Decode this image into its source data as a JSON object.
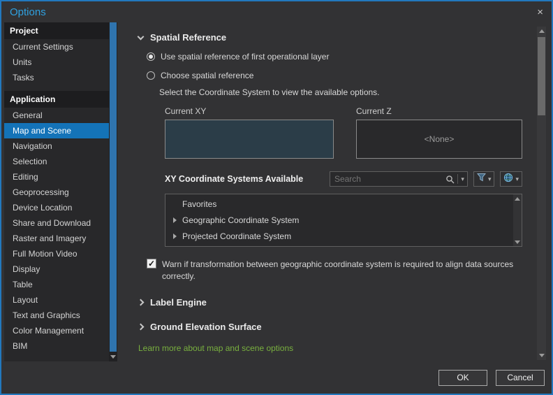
{
  "window": {
    "title": "Options"
  },
  "icons": {
    "close": "×",
    "caret_down": "▾",
    "check": "✓"
  },
  "colors": {
    "window_border_blue": "#2278BE",
    "selection_blue": "#1473B8",
    "title_blue": "#2FA1E0",
    "link_green": "#79B03F",
    "current_xy_fill": "#2B3D48"
  },
  "sidebar": {
    "sections": [
      {
        "header": "Project",
        "items": [
          {
            "label": "Current Settings"
          },
          {
            "label": "Units"
          },
          {
            "label": "Tasks"
          }
        ]
      },
      {
        "header": "Application",
        "items": [
          {
            "label": "General"
          },
          {
            "label": "Map and Scene",
            "selected": true
          },
          {
            "label": "Navigation"
          },
          {
            "label": "Selection"
          },
          {
            "label": "Editing"
          },
          {
            "label": "Geoprocessing"
          },
          {
            "label": "Device Location"
          },
          {
            "label": "Share and Download"
          },
          {
            "label": "Raster and Imagery"
          },
          {
            "label": "Full Motion Video"
          },
          {
            "label": "Display"
          },
          {
            "label": "Table"
          },
          {
            "label": "Layout"
          },
          {
            "label": "Text and Graphics"
          },
          {
            "label": "Color Management"
          },
          {
            "label": "BIM"
          }
        ]
      }
    ]
  },
  "main": {
    "spatial": {
      "title": "Spatial Reference",
      "radio_first_layer": "Use spatial reference of first operational layer",
      "radio_choose": "Choose spatial reference",
      "helper": "Select the Coordinate System to view the available options.",
      "current_xy_label": "Current XY",
      "current_z_label": "Current Z",
      "current_z_value": "<None>",
      "xy_available_label": "XY Coordinate Systems Available",
      "search_placeholder": "Search",
      "list": [
        {
          "label": "Favorites",
          "expandable": false
        },
        {
          "label": "Geographic Coordinate System",
          "expandable": true
        },
        {
          "label": "Projected Coordinate System",
          "expandable": true
        }
      ],
      "warn_checkbox_checked": true,
      "warn_text": "Warn if transformation between geographic coordinate system is required to align data sources correctly."
    },
    "label_engine": {
      "title": "Label Engine"
    },
    "ground_elevation": {
      "title": "Ground Elevation Surface"
    },
    "link": "Learn more about map and scene options"
  },
  "footer": {
    "ok": "OK",
    "cancel": "Cancel"
  }
}
